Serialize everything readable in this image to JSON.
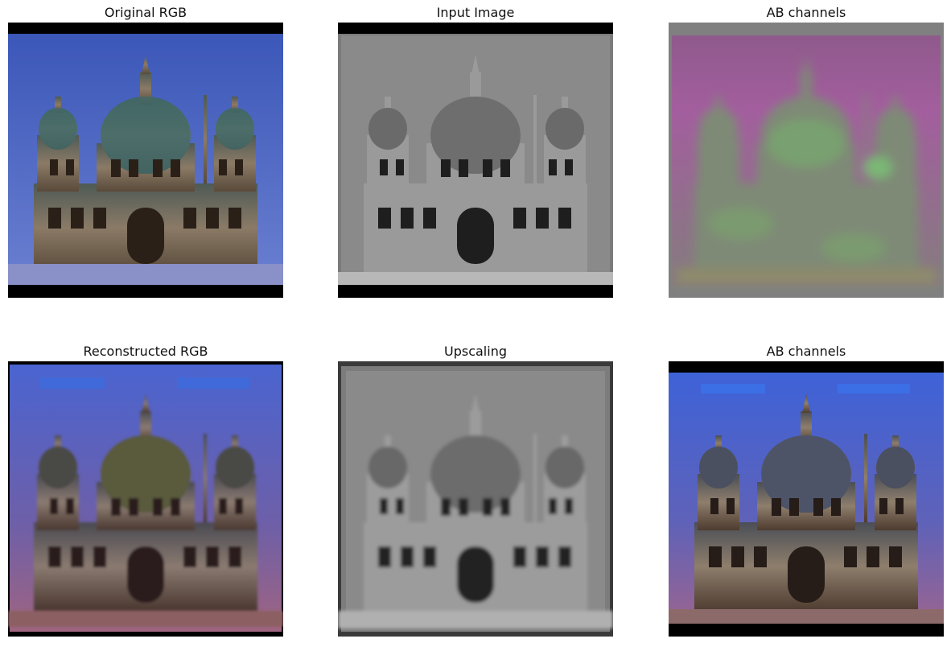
{
  "panels": [
    {
      "title": "Original RGB"
    },
    {
      "title": "Input Image"
    },
    {
      "title": "AB channels"
    },
    {
      "title": "Reconstructed RGB"
    },
    {
      "title": "Upscaling"
    },
    {
      "title": "AB channels"
    }
  ]
}
